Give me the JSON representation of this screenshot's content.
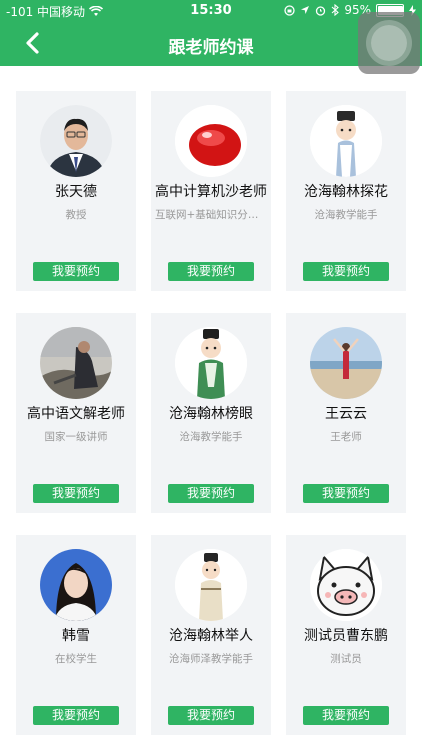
{
  "status_bar": {
    "carrier": "-101 中国移动",
    "time": "15:30",
    "battery": "95%",
    "battery_level": 0.95
  },
  "nav": {
    "title": "跟老师约课"
  },
  "teachers": [
    {
      "name": "张天德",
      "subtitle": "教授",
      "button": "我要预约"
    },
    {
      "name": "高中计算机沙老师",
      "subtitle": "互联网+基础知识分享...",
      "button": "我要预约"
    },
    {
      "name": "沧海翰林探花",
      "subtitle": "沧海教学能手",
      "button": "我要预约"
    },
    {
      "name": "高中语文解老师",
      "subtitle": "国家一级讲师",
      "button": "我要预约"
    },
    {
      "name": "沧海翰林榜眼",
      "subtitle": "沧海教学能手",
      "button": "我要预约"
    },
    {
      "name": "王云云",
      "subtitle": "王老师",
      "button": "我要预约"
    },
    {
      "name": "韩雪",
      "subtitle": "在校学生",
      "button": "我要预约"
    },
    {
      "name": "沧海翰林举人",
      "subtitle": "沧海师泽教学能手",
      "button": "我要预约"
    },
    {
      "name": "测试员曹东鹏",
      "subtitle": "测试员",
      "button": "我要预约"
    }
  ],
  "colors": {
    "accent": "#2fb463",
    "card_bg": "#f2f4f6"
  }
}
